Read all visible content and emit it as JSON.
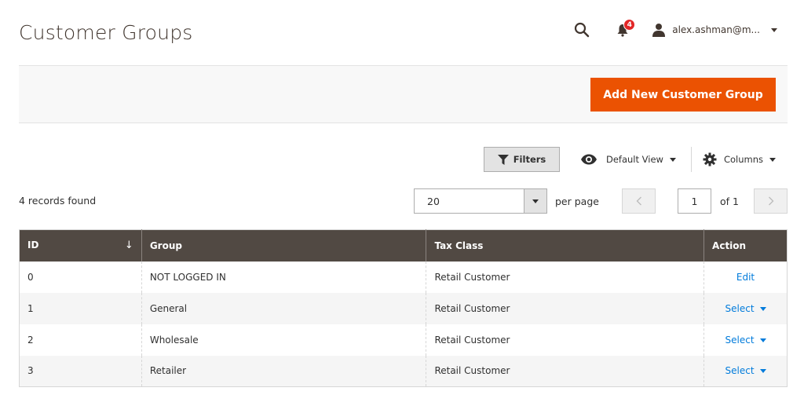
{
  "header": {
    "title": "Customer Groups",
    "notification_count": "4",
    "user_name": "alex.ashman@m..."
  },
  "action_bar": {
    "add_button_label": "Add New Customer Group"
  },
  "toolbar": {
    "filters_label": "Filters",
    "view_label": "Default View",
    "columns_label": "Columns"
  },
  "grid_info": {
    "records_found": "4 records found",
    "per_page_value": "20",
    "per_page_label": "per page",
    "current_page": "1",
    "page_of": "of 1"
  },
  "table": {
    "columns": [
      "ID",
      "Group",
      "Tax Class",
      "Action"
    ],
    "rows": [
      {
        "id": "0",
        "group": "NOT LOGGED IN",
        "tax_class": "Retail Customer",
        "action": "Edit"
      },
      {
        "id": "1",
        "group": "General",
        "tax_class": "Retail Customer",
        "action": "Select"
      },
      {
        "id": "2",
        "group": "Wholesale",
        "tax_class": "Retail Customer",
        "action": "Select"
      },
      {
        "id": "3",
        "group": "Retailer",
        "tax_class": "Retail Customer",
        "action": "Select"
      }
    ]
  },
  "colors": {
    "accent": "#eb5202",
    "table_header": "#514943",
    "link": "#007bdb",
    "badge": "#e22626"
  }
}
